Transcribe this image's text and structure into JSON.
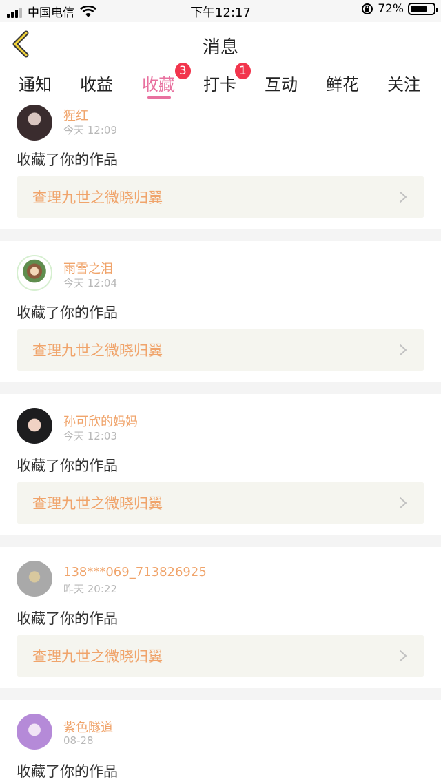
{
  "status_bar": {
    "carrier": "中国电信",
    "time": "下午12:17",
    "battery": "72%",
    "battery_level": 0.72,
    "icons": [
      "signal-icon",
      "wifi-icon",
      "rotation-lock-icon",
      "battery-icon"
    ]
  },
  "header": {
    "title": "消息",
    "back_icon": "chevron-left-icon"
  },
  "tabs": [
    {
      "label": "通知"
    },
    {
      "label": "收益"
    },
    {
      "label": "收藏",
      "badge": "3",
      "active": true
    },
    {
      "label": "打卡",
      "badge": "1"
    },
    {
      "label": "互动"
    },
    {
      "label": "鲜花"
    },
    {
      "label": "关注"
    }
  ],
  "colors": {
    "accent": "#e8719f",
    "username": "#f0a46b",
    "badge": "#f2354d",
    "work_row_bg": "#f5f5ef"
  },
  "notifications": [
    {
      "username": "猩红",
      "time": "今天 12:09",
      "action": "收藏了你的作品",
      "work_title": "查理九世之微晓归翼"
    },
    {
      "username": "雨雪之泪",
      "time": "今天 12:04",
      "action": "收藏了你的作品",
      "work_title": "查理九世之微晓归翼"
    },
    {
      "username": "孙可欣的妈妈",
      "time": "今天 12:03",
      "action": "收藏了你的作品",
      "work_title": "查理九世之微晓归翼"
    },
    {
      "username": "138***069_713826925",
      "time": "昨天 20:22",
      "action": "收藏了你的作品",
      "work_title": "查理九世之微晓归翼"
    },
    {
      "username": "紫色隧道",
      "time": "08-28",
      "action": "收藏了你的作品"
    }
  ]
}
